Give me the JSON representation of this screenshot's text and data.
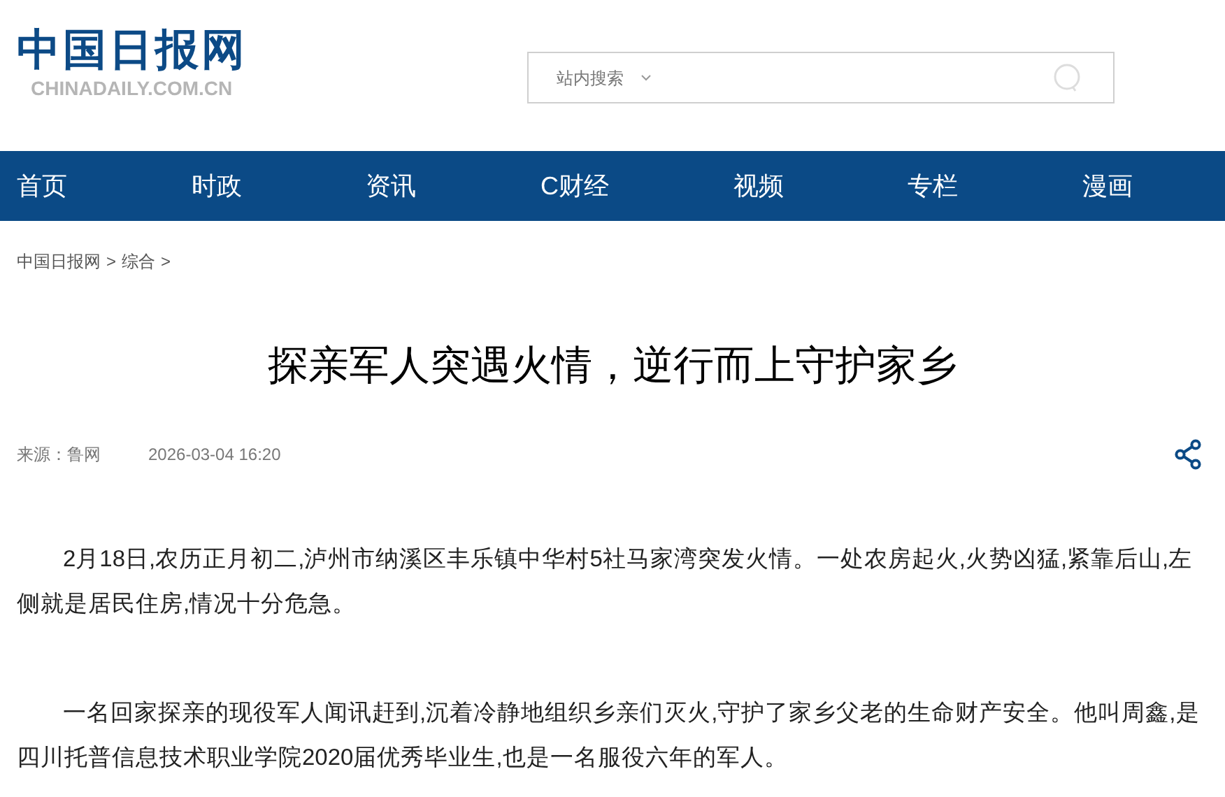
{
  "logo": {
    "name": "中国日报网",
    "domain": "CHINADAILY.COM.CN"
  },
  "search": {
    "scope": "站内搜索"
  },
  "nav": [
    {
      "label": "首页"
    },
    {
      "label": "时政"
    },
    {
      "label": "资讯"
    },
    {
      "label": "C财经"
    },
    {
      "label": "视频"
    },
    {
      "label": "专栏"
    },
    {
      "label": "漫画"
    }
  ],
  "breadcrumb": [
    {
      "label": "中国日报网",
      "separator": ">"
    },
    {
      "label": "综合",
      "separator": ">"
    }
  ],
  "article": {
    "title": "探亲军人突遇火情，逆行而上守护家乡",
    "source": "来源：鲁网",
    "date": "2026-03-04 16:20",
    "paragraphs": [
      "2月18日,农历正月初二,泸州市纳溪区丰乐镇中华村5社马家湾突发火情。一处农房起火,火势凶猛,紧靠后山,左侧就是居民住房,情况十分危急。",
      "一名回家探亲的现役军人闻讯赶到,沉着冷静地组织乡亲们灭火,守护了家乡父老的生命财产安全。他叫周鑫,是四川托普信息技术职业学院2020届优秀毕业生,也是一名服役六年的军人。"
    ]
  }
}
